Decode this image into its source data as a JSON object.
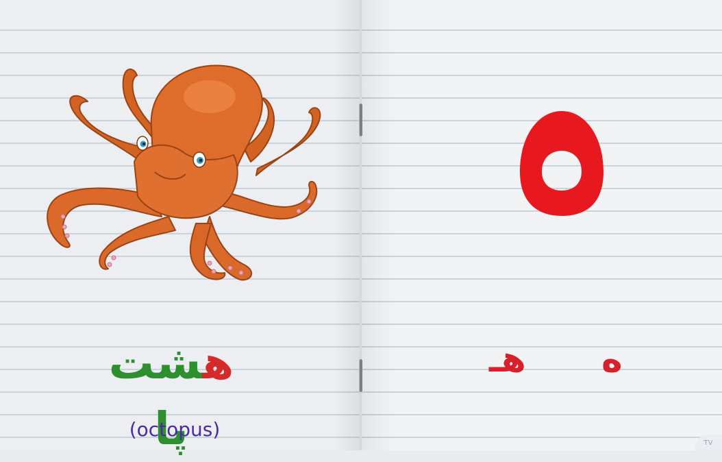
{
  "lesson": {
    "word": {
      "highlight": "ه",
      "rest": "شت پا"
    },
    "translation": "(octopus)",
    "letter": {
      "big_icon": "persian-digit-five-like-he-glyph",
      "isolated_form": "ه",
      "initial_form": "هـ"
    }
  },
  "images": {
    "illustration": "octopus-illustration"
  },
  "colors": {
    "letter_red": "#e8181f",
    "word_green": "#2e8f2e",
    "word_red": "#d52a2a",
    "translation_purple": "#4a2aa6",
    "octopus_orange": "#d9692a"
  },
  "badge": {
    "text": "TV"
  }
}
